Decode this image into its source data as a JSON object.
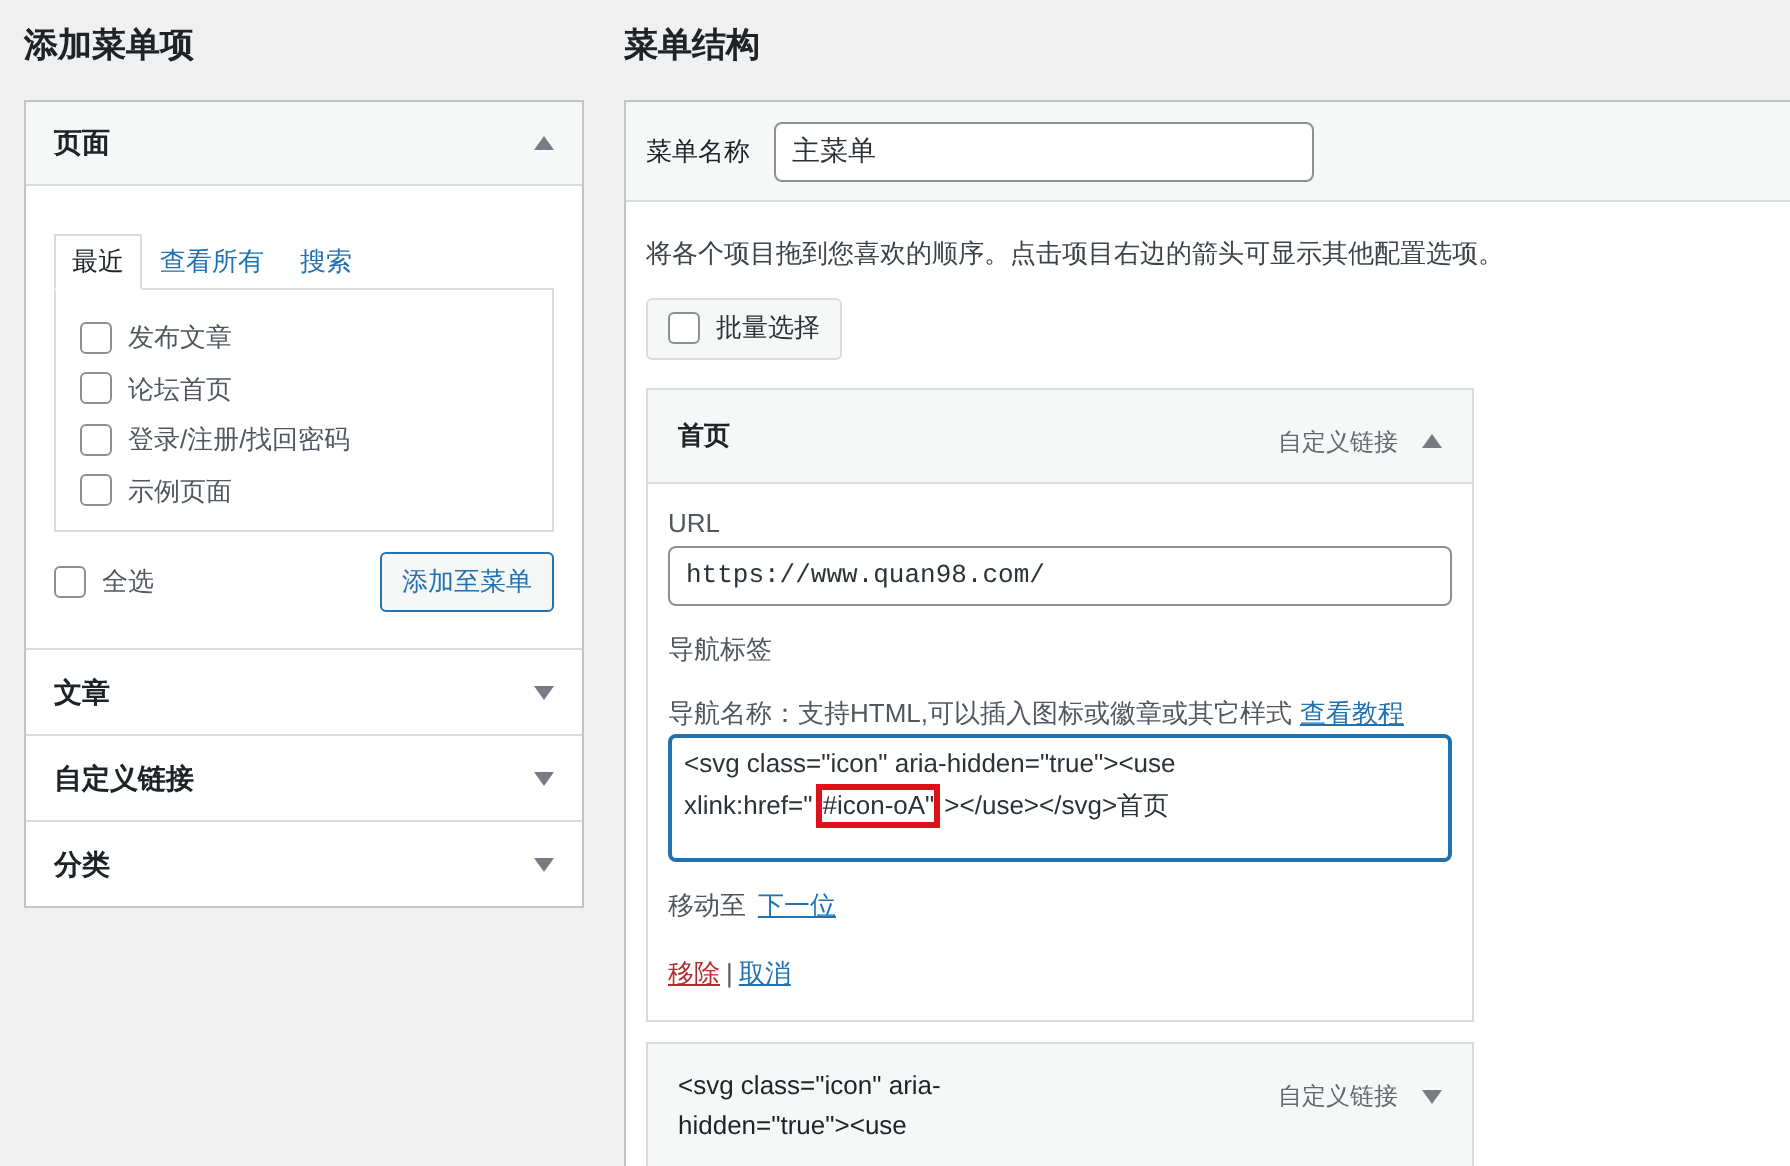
{
  "left": {
    "heading": "添加菜单项",
    "sections": [
      {
        "title": "页面",
        "expanded": true,
        "tabs": [
          {
            "label": "最近",
            "selected": true
          },
          {
            "label": "查看所有",
            "selected": false
          },
          {
            "label": "搜索",
            "selected": false
          }
        ],
        "items": [
          {
            "label": "发布文章",
            "checked": false
          },
          {
            "label": "论坛首页",
            "checked": false
          },
          {
            "label": "登录/注册/找回密码",
            "checked": false
          },
          {
            "label": "示例页面",
            "checked": false
          }
        ],
        "select_all": {
          "label": "全选",
          "checked": false
        },
        "add_button": "添加至菜单"
      },
      {
        "title": "文章",
        "expanded": false
      },
      {
        "title": "自定义链接",
        "expanded": false
      },
      {
        "title": "分类",
        "expanded": false
      }
    ]
  },
  "right": {
    "heading": "菜单结构",
    "menu_name": {
      "label": "菜单名称",
      "value": "主菜单"
    },
    "instructions": "将各个项目拖到您喜欢的顺序。点击项目右边的箭头可显示其他配置选项。",
    "bulk_select": {
      "label": "批量选择",
      "checked": false
    },
    "items": [
      {
        "title": "首页",
        "type": "自定义链接",
        "expanded": true,
        "url_label": "URL",
        "url": "https://www.quan98.com/",
        "nav_label": "导航标签",
        "nav_hint": "导航名称：支持HTML,可以插入图标或徽章或其它样式",
        "hint_link": "查看教程",
        "nav_value_before": "<svg class=\"icon\" aria-hidden=\"true\"><use xlink:href=\"",
        "nav_value_highlighted": "#icon-oA\"",
        "nav_value_after": "></use></svg>首页",
        "move_label": "移动至",
        "move_link": "下一位",
        "remove": "移除",
        "separator": "|",
        "cancel": "取消"
      },
      {
        "title": "<svg class=\"icon\" aria-hidden=\"true\"><use",
        "type": "自定义链接",
        "expanded": false
      }
    ]
  }
}
